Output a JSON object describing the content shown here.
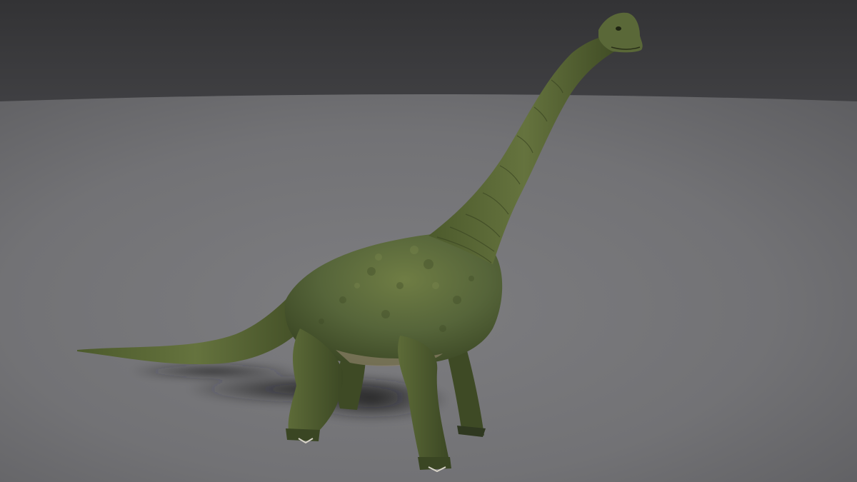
{
  "scene": {
    "subject": "brachiosaurus-3d-model",
    "colors": {
      "backdrop_top": "#343436",
      "backdrop_bottom": "#3e3e41",
      "floor_far": "#6a6a6d",
      "floor_near": "#7b7b7e",
      "skin_base": "#5a6a36",
      "skin_dark": "#3d4a22",
      "skin_light": "#7d8a4f",
      "belly": "#8a7f66",
      "shadow": "#1c1c1e"
    }
  }
}
